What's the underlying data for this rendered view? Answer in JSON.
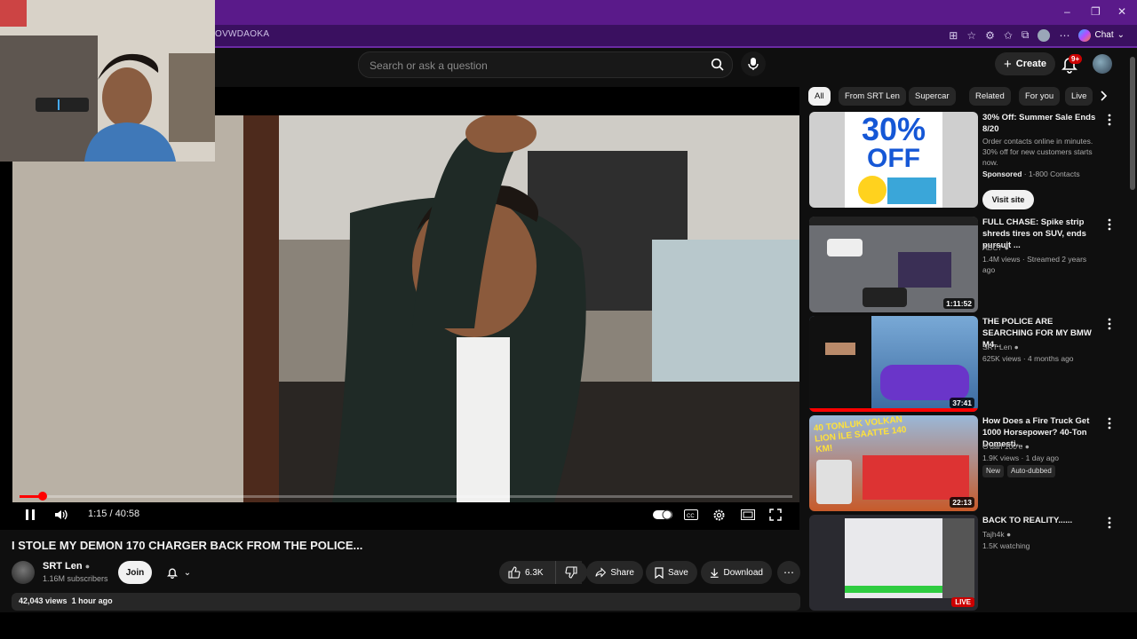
{
  "browser": {
    "url_fragment": "OVWDAOKA",
    "chat_label": "Chat",
    "win_min": "–",
    "win_max": "❐",
    "win_close": "✕"
  },
  "youtube": {
    "search_placeholder": "Search or ask a question",
    "create_label": "Create",
    "notif_badge": "9+"
  },
  "player": {
    "time": "1:15 / 40:58",
    "progress": 0.03
  },
  "video": {
    "title": "I STOLE MY DEMON 170 CHARGER BACK FROM THE POLICE...",
    "channel": "SRT Len",
    "subscribers": "1.16M subscribers",
    "join_label": "Join",
    "likes": "6.3K",
    "share_label": "Share",
    "save_label": "Save",
    "download_label": "Download",
    "views": "42,043 views",
    "age": "1 hour ago"
  },
  "chips": [
    "All",
    "From SRT Len",
    "Supercar",
    "Related",
    "For you",
    "Live"
  ],
  "recommendations": [
    {
      "title": "30% Off: Summer Sale Ends 8/20",
      "line1": "Order contacts online in minutes. 30% off for new customers starts now.",
      "sponsored": "Sponsored",
      "advertiser": "· 1-800 Contacts",
      "visit_label": "Visit site",
      "thumb_big": "30%",
      "thumb_off": "OFF"
    },
    {
      "title": "FULL CHASE: Spike strip shreds tires on SUV, ends pursuit ...",
      "channel": "ABC7",
      "meta": "1.4M views · Streamed 2 years ago",
      "duration": "1:11:52"
    },
    {
      "title": "THE POLICE ARE SEARCHING FOR MY BMW M4...",
      "channel": "SRT Len",
      "meta": "625K views · 4 months ago",
      "duration": "37:41"
    },
    {
      "title": "How Does a Fire Truck Get 1000 Horsepower? 40-Ton Domesti...",
      "channel": "O'dan 100'e",
      "meta": "1.9K views · 1 day ago",
      "badge_new": "New",
      "badge_dub": "Auto-dubbed",
      "duration": "22:13",
      "thumb_text": "40 TONLUK VOLKAN LION İLE SAATTE 140 KM!"
    },
    {
      "title": "BACK TO REALITY......",
      "channel": "Tajh4k",
      "meta": "1.5K watching",
      "live": "LIVE"
    }
  ],
  "colors": {
    "browser_frame": "#5a1a8a",
    "youtube_bg": "#0f0f0f",
    "progress": "#ff0000"
  }
}
